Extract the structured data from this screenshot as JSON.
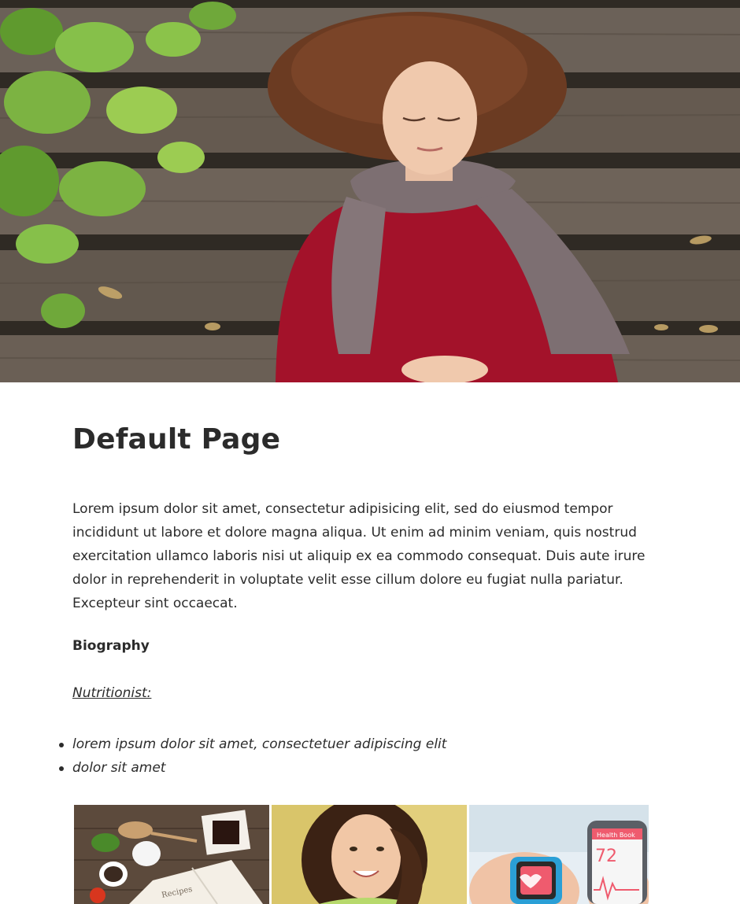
{
  "hero": {
    "alt": "Woman lying on wooden planks wearing a red sweater and grey knitted scarf"
  },
  "page": {
    "title": "Default Page",
    "intro": "Lorem ipsum dolor sit amet, consectetur adipisicing elit, sed do eiusmod tempor incididunt ut labore et dolore magna aliqua. Ut enim ad minim veniam, quis nostrud exercitation ullamco laboris nisi ut aliquip ex ea commodo consequat. Duis aute irure dolor in reprehenderit in voluptate velit esse cillum dolore eu fugiat nulla pariatur. Excepteur sint occaecat.",
    "bio_heading": "Biography",
    "role": "Nutritionist:",
    "bullets": [
      "lorem ipsum dolor sit amet, consectetuer adipiscing elit",
      "dolor sit amet"
    ]
  },
  "gallery": {
    "items": [
      {
        "name": "recipes-photo",
        "book_label": "Recipes"
      },
      {
        "name": "smiling-woman-photo"
      },
      {
        "name": "health-app-photo",
        "app_title": "Health Book",
        "value": "72"
      }
    ]
  },
  "colors": {
    "text": "#2b2b2b",
    "sweater": "#a3122a",
    "wood": "#5b5047",
    "leaves": "#7cb342"
  }
}
